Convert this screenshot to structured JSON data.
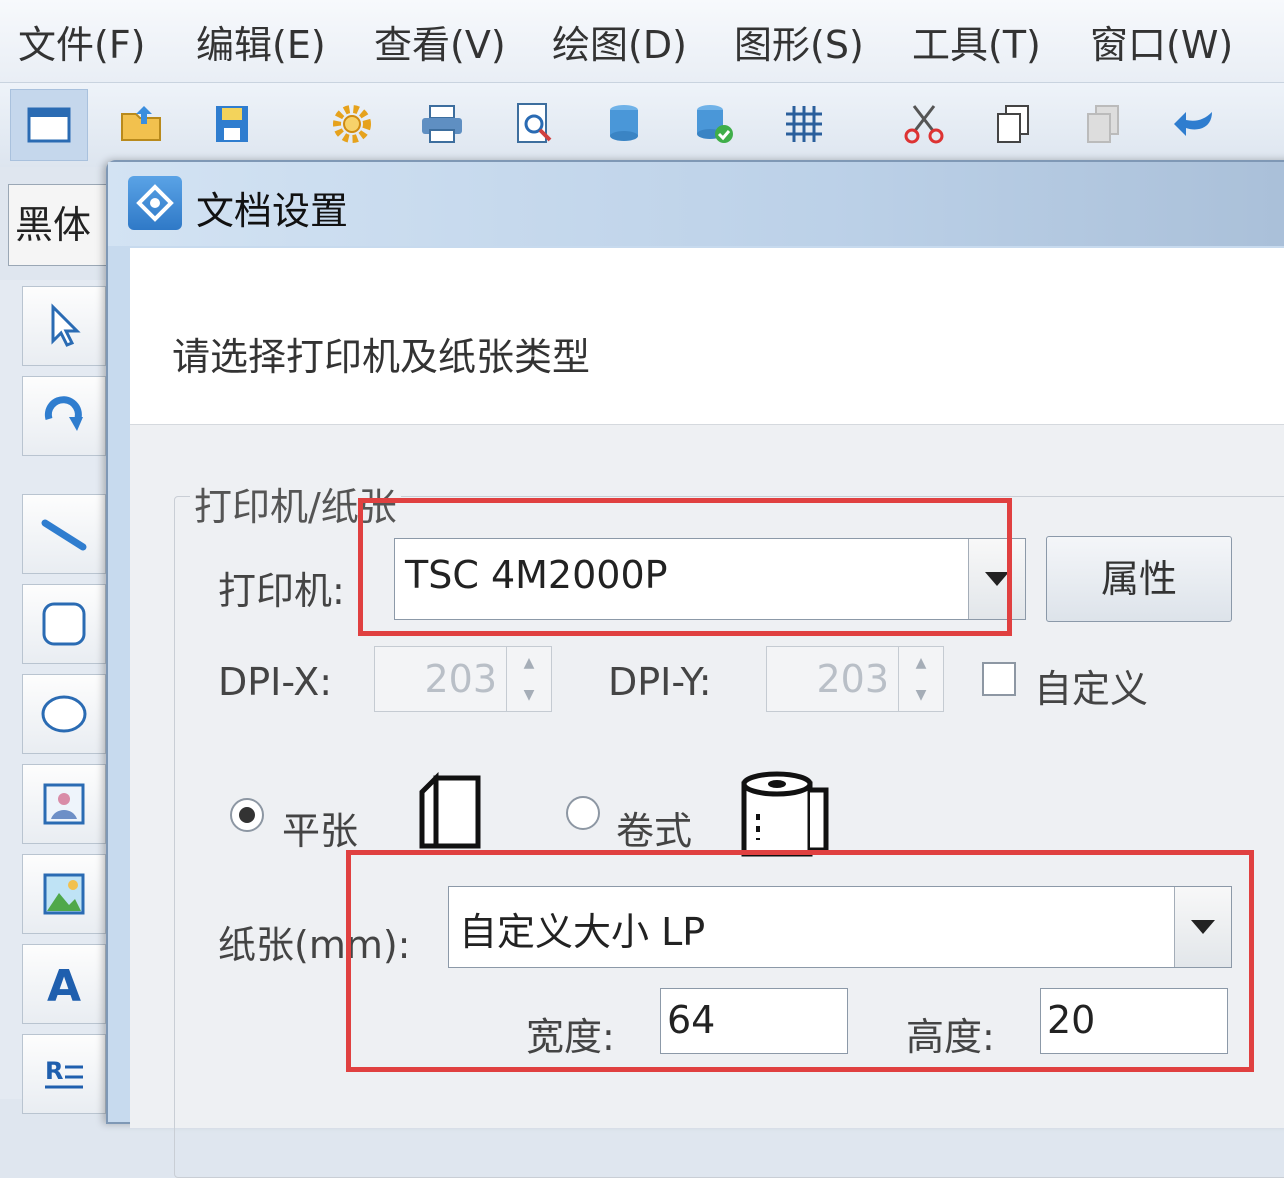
{
  "menu": {
    "items": [
      "文件(F)",
      "编辑(E)",
      "查看(V)",
      "绘图(D)",
      "图形(S)",
      "工具(T)",
      "窗口(W)"
    ]
  },
  "toolbar": {
    "icons": [
      "new-document-icon",
      "open-folder-icon",
      "save-icon",
      "settings-gear-icon",
      "print-icon",
      "print-preview-icon",
      "database-icon",
      "database-connect-icon",
      "grid-icon",
      "cut-icon",
      "copy-icon",
      "paste-icon",
      "undo-icon"
    ]
  },
  "font_selector": {
    "value": "黑体"
  },
  "tools": {
    "icons": [
      "select-pointer-icon",
      "rotate-icon",
      "line-icon",
      "rounded-rect-icon",
      "ellipse-icon",
      "image-icon",
      "picture-icon",
      "text-icon",
      "rich-text-icon"
    ]
  },
  "dialog": {
    "title": "文档设置",
    "header": "请选择打印机及纸张类型",
    "group_label": "打印机/纸张",
    "printer_label": "打印机:",
    "printer_value": "TSC 4M2000P",
    "properties_button": "属性",
    "dpi_x_label": "DPI-X:",
    "dpi_x_value": "203",
    "dpi_y_label": "DPI-Y:",
    "dpi_y_value": "203",
    "custom_label": "自定义",
    "flat_label": "平张",
    "roll_label": "卷式",
    "paper_label": "纸张(mm):",
    "paper_value": "自定义大小 LP",
    "width_label": "宽度:",
    "width_value": "64",
    "height_label": "高度:",
    "height_value": "20"
  },
  "colors": {
    "highlight": "#e04040",
    "titlebar": "#c7daee"
  }
}
